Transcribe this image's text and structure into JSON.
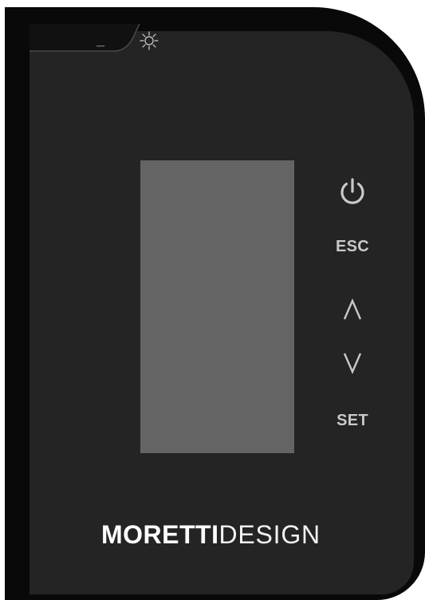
{
  "device": {
    "indicator_dash": "_",
    "display": {
      "screen_color": "#646464"
    },
    "buttons": {
      "power_icon": "power-icon",
      "esc_label": "ESC",
      "up_label": "Λ",
      "down_label": "V",
      "set_label": "SET"
    },
    "brand": {
      "strong": "MORETTI",
      "light": "DESIGN"
    },
    "colors": {
      "frame": "#090909",
      "panel": "#242424",
      "button_text": "#c9c9c9",
      "brand_text": "#ffffff"
    }
  }
}
